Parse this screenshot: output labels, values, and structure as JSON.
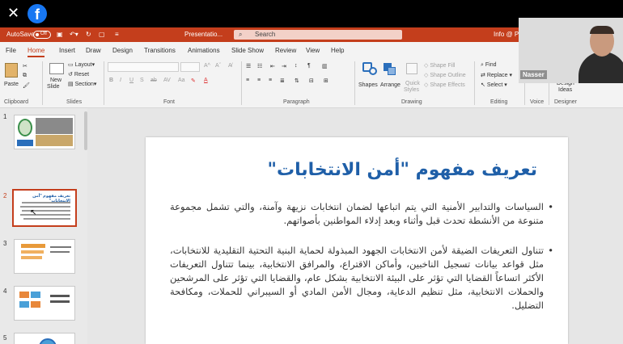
{
  "overlay": {
    "close_glyph": "✕",
    "facebook_glyph": "f"
  },
  "titlebar": {
    "autosave_label": "AutoSave",
    "autosave_state": "Off",
    "filename": "Presentatio...",
    "search_placeholder": "Search",
    "user_partial": "Info @ PS..."
  },
  "tabs": [
    "File",
    "Home",
    "Insert",
    "Draw",
    "Design",
    "Transitions",
    "Animations",
    "Slide Show",
    "Review",
    "View",
    "Help"
  ],
  "active_tab": "Home",
  "ribbon": {
    "clipboard": {
      "paste": "Paste",
      "group": "Clipboard"
    },
    "slides": {
      "new_slide_1": "New",
      "new_slide_2": "Slide",
      "layout": "Layout",
      "reset": "Reset",
      "section": "Section",
      "group": "Slides"
    },
    "font": {
      "group": "Font"
    },
    "paragraph": {
      "group": "Paragraph"
    },
    "drawing": {
      "shapes": "Shapes",
      "arrange": "Arrange",
      "quick_styles_1": "Quick",
      "quick_styles_2": "Styles",
      "shape_fill": "Shape Fill",
      "shape_outline": "Shape Outline",
      "shape_effects": "Shape Effects",
      "group": "Drawing"
    },
    "editing": {
      "find": "Find",
      "replace": "Replace",
      "select": "Select",
      "group": "Editing"
    },
    "voice": {
      "group": "Voice"
    },
    "designer": {
      "design": "Design",
      "ideas": "Ideas",
      "group": "Designer"
    }
  },
  "thumbnails": [
    {
      "num": "1"
    },
    {
      "num": "2",
      "title": "تعريف مفهوم \"أمن الانتخابات\""
    },
    {
      "num": "3"
    },
    {
      "num": "4"
    },
    {
      "num": "5"
    }
  ],
  "selected_slide": 2,
  "slide": {
    "title": "تعريف مفهوم \"أمن الانتخابات\"",
    "bullets": [
      "السياسات والتدابير الأمنية التي يتم اتباعها لضمان انتخابات نزيهة وآمنة، والتي تشمل مجموعة متنوعة من الأنشطة تحدث قبل وأثناء وبعد إدلاء المواطنين بأصواتهم.",
      "تتناول التعريفات الضيقة لأمن الانتخابات الجهود المبذولة لحماية البنية التحتية التقليدية للانتخابات، مثل قواعد بيانات تسجيل الناخبين، وأماكن الاقتراع، والمرافق الانتخابية، بينما تتناول التعريفات الأكثر اتساعاً القضايا التي تؤثر على البيئة الانتخابية بشكل عام، والقضايا التي تؤثر على المرشحين والحملات الانتخابية، مثل تنظيم الدعاية، ومجال الأمن المادي أو السيبراني للحملات، ومكافحة التضليل."
    ]
  },
  "webcam": {
    "name": "Nasser"
  },
  "colors": {
    "accent": "#c43e1c",
    "title_blue": "#1f5fa8"
  }
}
